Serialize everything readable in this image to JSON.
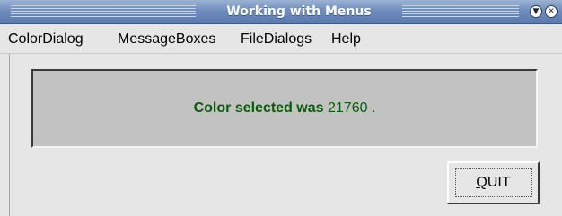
{
  "window": {
    "title": "Working with Menus"
  },
  "menubar": {
    "items": [
      "ColorDialog",
      "MessageBoxes",
      "FileDialogs",
      "Help"
    ]
  },
  "panel": {
    "message_label": "Color selected was",
    "message_value": "21760",
    "message_suffix": "."
  },
  "quit_button": {
    "mnemonic": "Q",
    "rest": "UIT"
  },
  "icons": {
    "window_menu": "window-menu-icon",
    "close": "close-icon"
  },
  "colors": {
    "titlebar": "#6f8cbd",
    "message_text": "#0b5a0b",
    "panel_bg": "#c2c2c2",
    "window_bg": "#e6e6e6"
  }
}
